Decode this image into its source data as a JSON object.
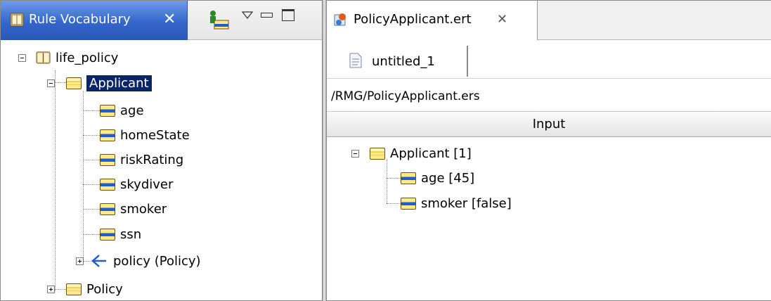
{
  "left_view": {
    "tab_label": "Rule Vocabulary",
    "tree": [
      {
        "label": "life_policy",
        "level": 0,
        "icon": "book-icon",
        "expander": "minus"
      },
      {
        "label": "Applicant",
        "level": 1,
        "icon": "entity-icon",
        "expander": "minus",
        "selected": true
      },
      {
        "label": "age",
        "level": 2,
        "icon": "attribute-icon"
      },
      {
        "label": "homeState",
        "level": 2,
        "icon": "attribute-icon"
      },
      {
        "label": "riskRating",
        "level": 2,
        "icon": "attribute-icon"
      },
      {
        "label": "skydiver",
        "level": 2,
        "icon": "attribute-icon"
      },
      {
        "label": "smoker",
        "level": 2,
        "icon": "attribute-icon"
      },
      {
        "label": "ssn",
        "level": 2,
        "icon": "attribute-icon"
      },
      {
        "label": "policy (Policy)",
        "level": 2,
        "icon": "association-icon",
        "expander": "plus"
      },
      {
        "label": "Policy",
        "level": 1,
        "icon": "entity-icon",
        "expander": "plus"
      }
    ]
  },
  "right_view": {
    "editor_tab_label": "PolicyApplicant.ert",
    "subtab_label": "untitled_1",
    "path": "/RMG/PolicyApplicant.ers",
    "input_header": "Input",
    "tree": [
      {
        "label": "Applicant [1]",
        "level": 0,
        "icon": "entity-icon",
        "expander": "minus"
      },
      {
        "label": "age [45]",
        "level": 1,
        "icon": "attribute-icon"
      },
      {
        "label": "smoker [false]",
        "level": 1,
        "icon": "attribute-icon"
      }
    ]
  },
  "colors": {
    "active_tab_blue": "#3366cc",
    "selection": "#0a246a",
    "close_x": "#ffffff"
  }
}
